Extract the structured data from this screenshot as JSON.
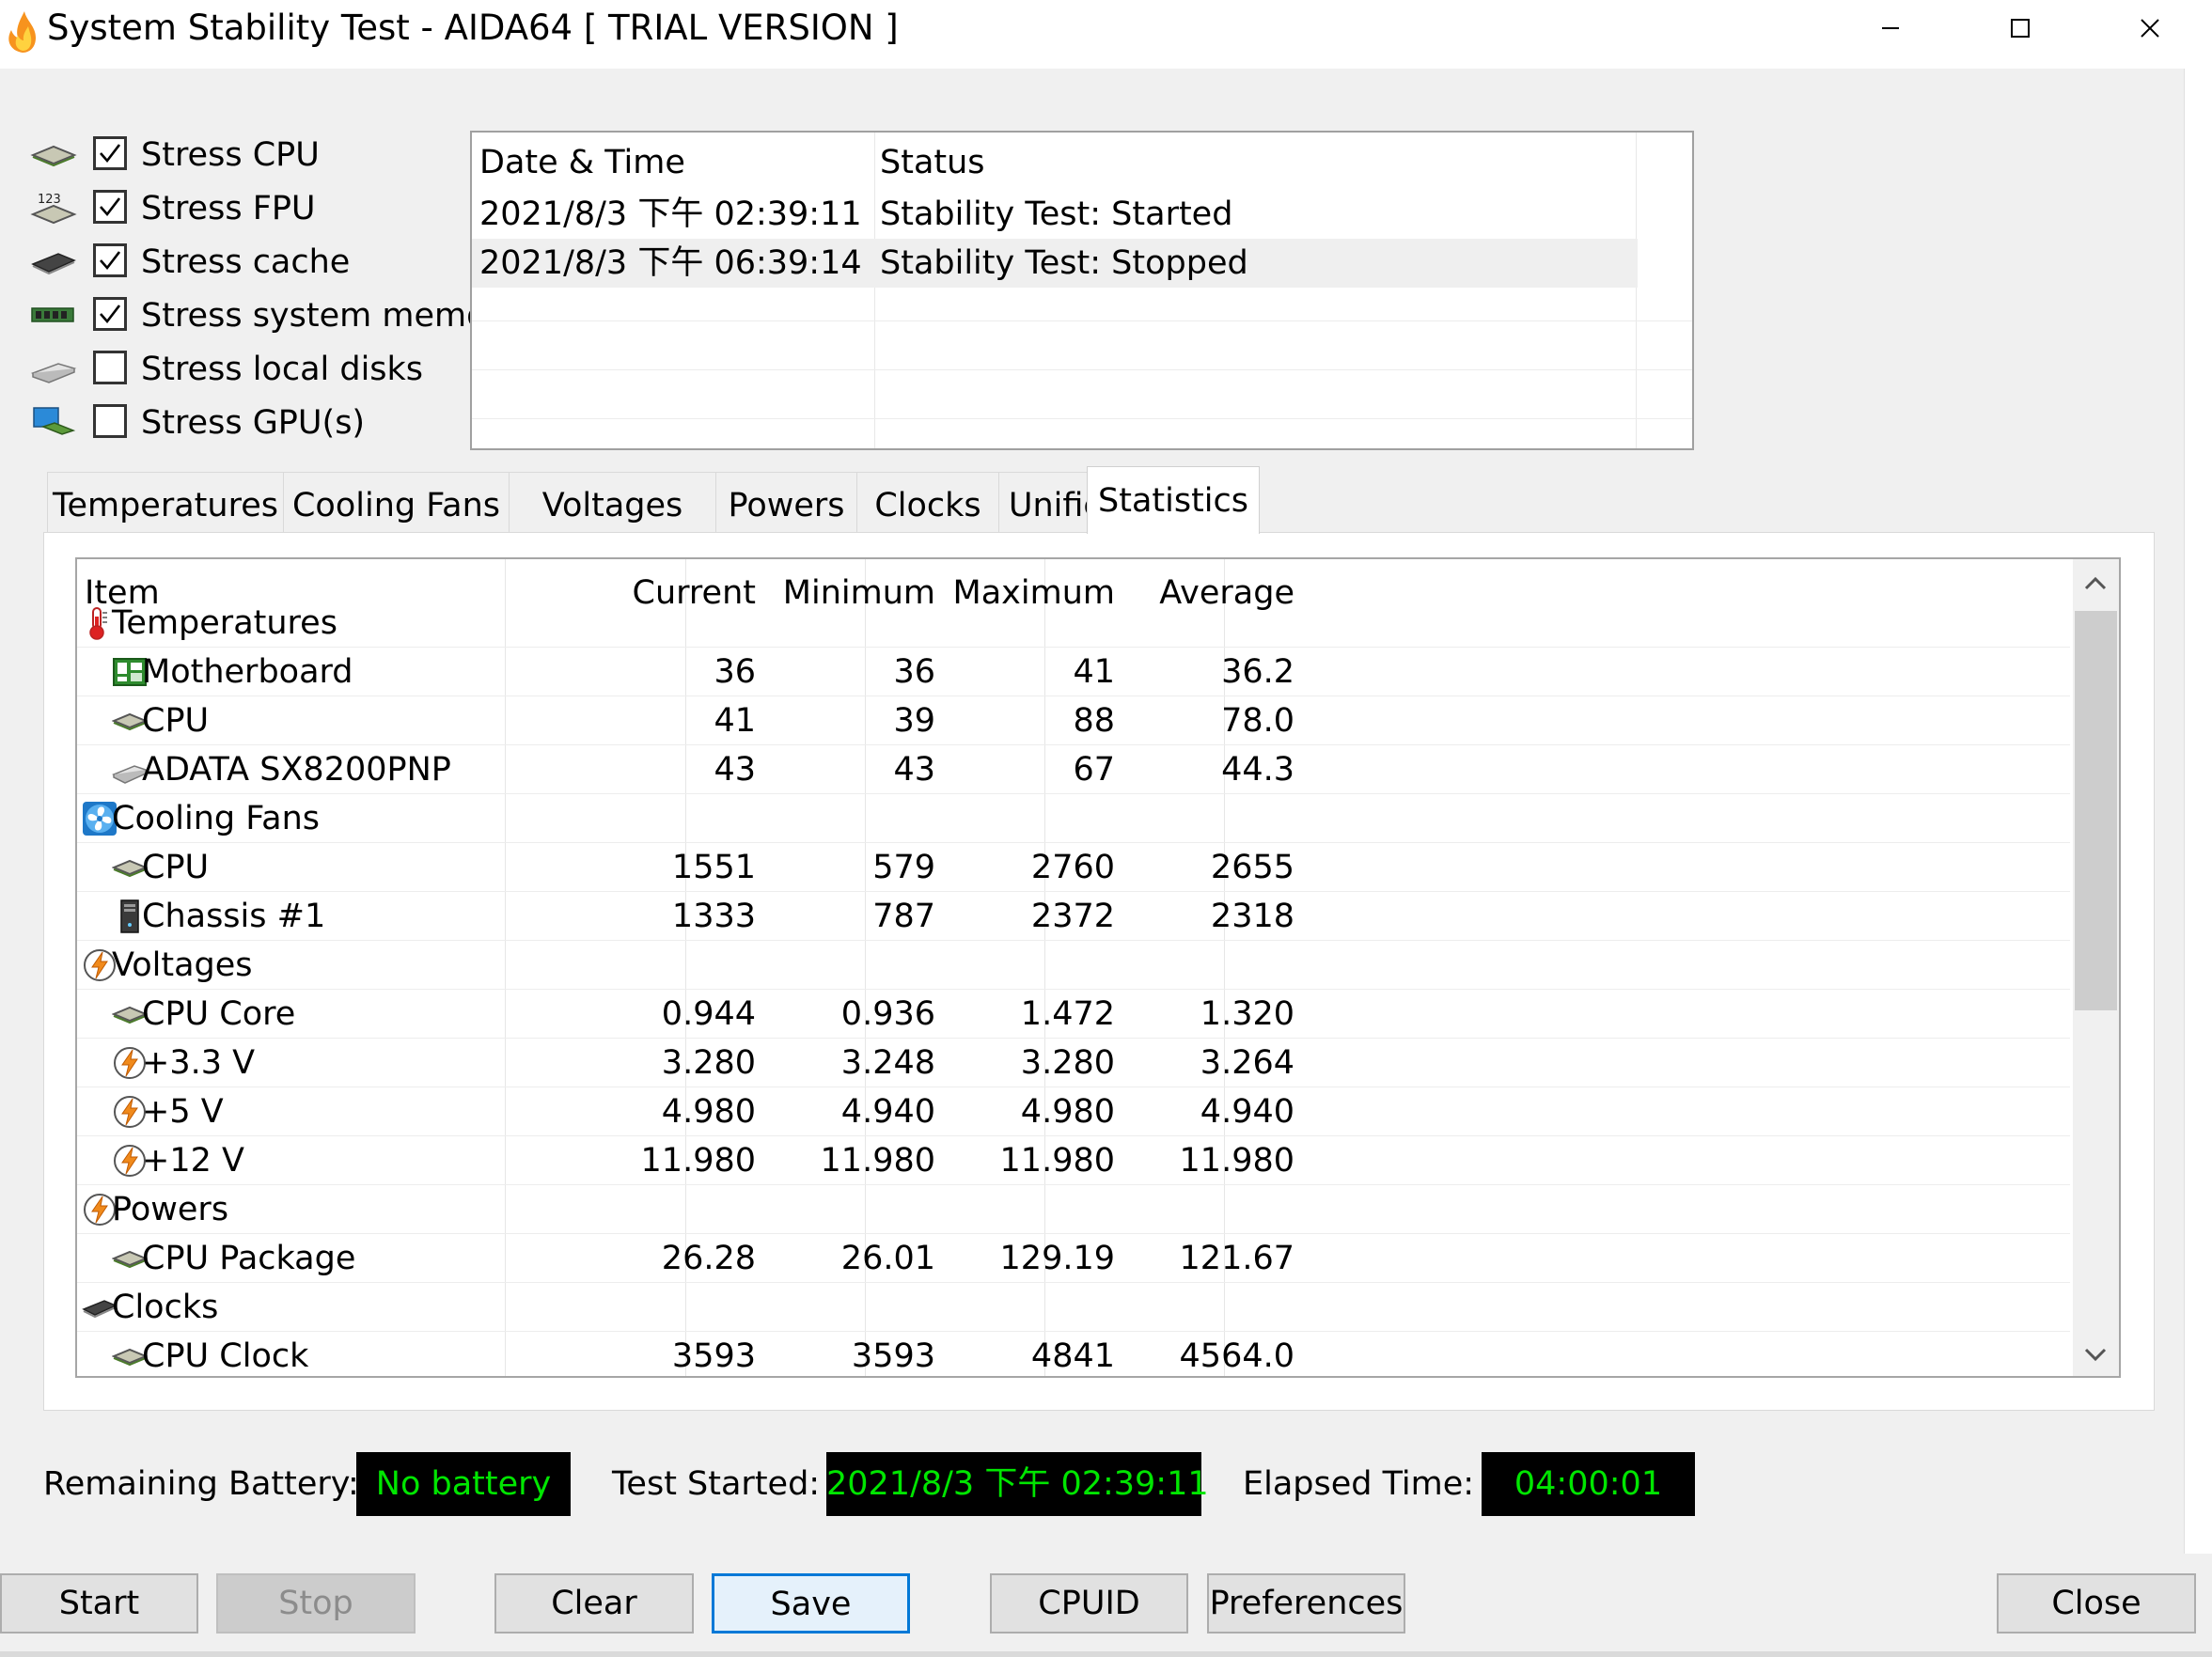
{
  "window": {
    "title": "System Stability Test - AIDA64  [ TRIAL VERSION ]",
    "app_icon": "flame-icon",
    "controls": [
      "minimize-icon",
      "maximize-icon",
      "close-icon"
    ]
  },
  "options": [
    {
      "label": "Stress CPU",
      "checked": true,
      "icon": "cpu-chip-icon"
    },
    {
      "label": "Stress FPU",
      "checked": true,
      "icon": "fpu-123-icon"
    },
    {
      "label": "Stress cache",
      "checked": true,
      "icon": "cache-chip-icon"
    },
    {
      "label": "Stress system memory",
      "checked": true,
      "icon": "memory-module-icon"
    },
    {
      "label": "Stress local disks",
      "checked": false,
      "icon": "disk-drive-icon"
    },
    {
      "label": "Stress GPU(s)",
      "checked": false,
      "icon": "gpu-monitor-icon"
    }
  ],
  "log": {
    "headers": [
      "Date & Time",
      "Status"
    ],
    "rows": [
      {
        "datetime": "2021/8/3 下午 02:39:11",
        "status": "Stability Test: Started"
      },
      {
        "datetime": "2021/8/3 下午 06:39:14",
        "status": "Stability Test: Stopped"
      }
    ]
  },
  "tabs": [
    "Temperatures",
    "Cooling Fans",
    "Voltages",
    "Powers",
    "Clocks",
    "Unified",
    "Statistics"
  ],
  "active_tab": "Statistics",
  "stats": {
    "headers": {
      "item": "Item",
      "current": "Current",
      "minimum": "Minimum",
      "maximum": "Maximum",
      "average": "Average"
    },
    "rows": [
      {
        "type": "group",
        "item": "Temperatures",
        "icon": "thermometer-icon"
      },
      {
        "type": "child",
        "item": "Motherboard",
        "icon": "motherboard-icon",
        "current": "36",
        "minimum": "36",
        "maximum": "41",
        "average": "36.2"
      },
      {
        "type": "child",
        "item": "CPU",
        "icon": "cpu-chip-icon",
        "current": "41",
        "minimum": "39",
        "maximum": "88",
        "average": "78.0"
      },
      {
        "type": "child",
        "item": "ADATA SX8200PNP",
        "icon": "disk-drive-icon",
        "current": "43",
        "minimum": "43",
        "maximum": "67",
        "average": "44.3"
      },
      {
        "type": "group",
        "item": "Cooling Fans",
        "icon": "fan-icon"
      },
      {
        "type": "child",
        "item": "CPU",
        "icon": "cpu-chip-icon",
        "current": "1551",
        "minimum": "579",
        "maximum": "2760",
        "average": "2655"
      },
      {
        "type": "child",
        "item": "Chassis #1",
        "icon": "chassis-icon",
        "current": "1333",
        "minimum": "787",
        "maximum": "2372",
        "average": "2318"
      },
      {
        "type": "group",
        "item": "Voltages",
        "icon": "lightning-icon"
      },
      {
        "type": "child",
        "item": "CPU Core",
        "icon": "cpu-chip-icon",
        "current": "0.944",
        "minimum": "0.936",
        "maximum": "1.472",
        "average": "1.320"
      },
      {
        "type": "child",
        "item": "+3.3 V",
        "icon": "lightning-icon",
        "current": "3.280",
        "minimum": "3.248",
        "maximum": "3.280",
        "average": "3.264"
      },
      {
        "type": "child",
        "item": "+5 V",
        "icon": "lightning-icon",
        "current": "4.980",
        "minimum": "4.940",
        "maximum": "4.980",
        "average": "4.940"
      },
      {
        "type": "child",
        "item": "+12 V",
        "icon": "lightning-icon",
        "current": "11.980",
        "minimum": "11.980",
        "maximum": "11.980",
        "average": "11.980"
      },
      {
        "type": "group",
        "item": "Powers",
        "icon": "lightning-icon"
      },
      {
        "type": "child",
        "item": "CPU Package",
        "icon": "cpu-chip-icon",
        "current": "26.28",
        "minimum": "26.01",
        "maximum": "129.19",
        "average": "121.67"
      },
      {
        "type": "group",
        "item": "Clocks",
        "icon": "cache-chip-icon"
      },
      {
        "type": "child",
        "item": "CPU Clock",
        "icon": "cpu-chip-icon",
        "current": "3593",
        "minimum": "3593",
        "maximum": "4841",
        "average": "4564.0"
      }
    ]
  },
  "status_bar": {
    "battery_label": "Remaining Battery:",
    "battery_value": "No battery",
    "started_label": "Test Started:",
    "started_value": "2021/8/3 下午 02:39:11",
    "elapsed_label": "Elapsed Time:",
    "elapsed_value": "04:00:01",
    "value_color": "#00e600",
    "value_background": "#000000"
  },
  "buttons": {
    "start": "Start",
    "stop": "Stop",
    "clear": "Clear",
    "save": "Save",
    "cpuid": "CPUID",
    "preferences": "Preferences",
    "close": "Close"
  },
  "colors": {
    "focus_border": "#0078d7",
    "disabled_text": "#8c8c8c"
  }
}
